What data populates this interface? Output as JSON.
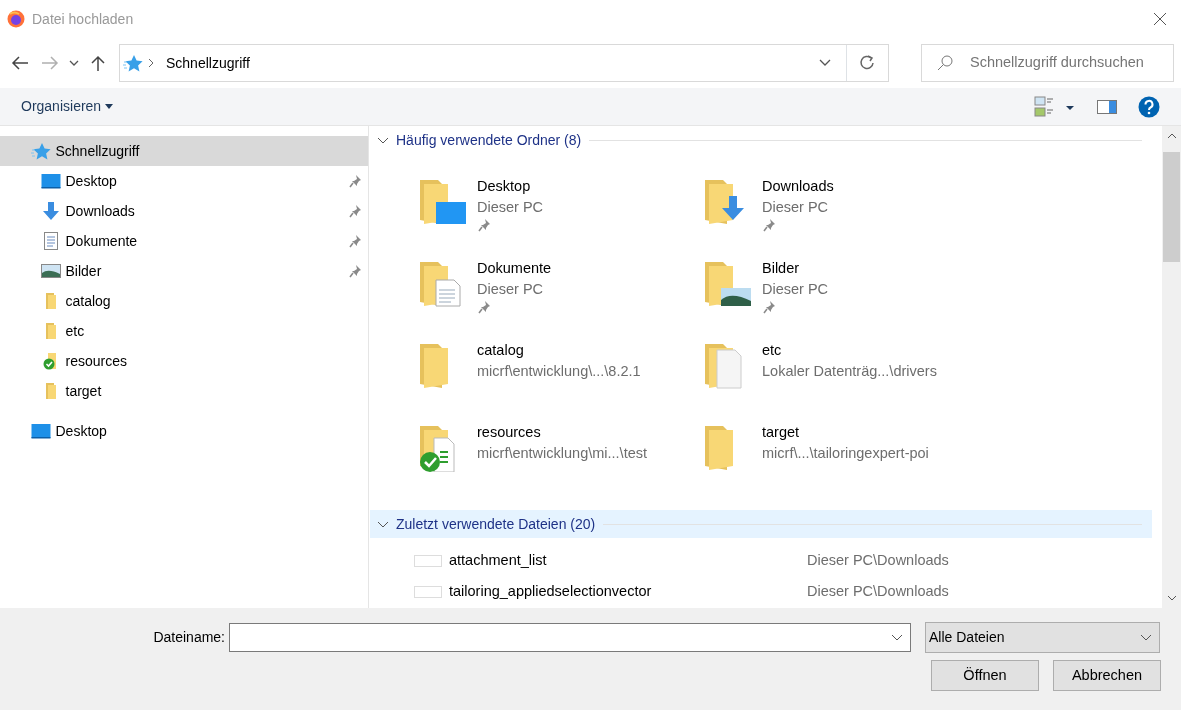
{
  "window": {
    "title": "Datei hochladen"
  },
  "nav": {
    "back": {
      "disabled": false
    },
    "forward": {
      "disabled": true
    },
    "address": {
      "location": "Schnellzugriff"
    },
    "search": {
      "placeholder": "Schnellzugriff durchsuchen"
    }
  },
  "toolbar": {
    "organize": "Organisieren"
  },
  "sidebar": {
    "items": [
      {
        "label": "Schnellzugriff",
        "kind": "quick",
        "selected": true,
        "pinned": false,
        "children": [
          {
            "label": "Desktop",
            "kind": "desktop",
            "selected": false,
            "pinned": true
          },
          {
            "label": "Downloads",
            "kind": "downloads",
            "selected": false,
            "pinned": true
          },
          {
            "label": "Dokumente",
            "kind": "documents",
            "selected": false,
            "pinned": true
          },
          {
            "label": "Bilder",
            "kind": "pictures",
            "selected": false,
            "pinned": true
          },
          {
            "label": "catalog",
            "kind": "folder",
            "selected": false,
            "pinned": false
          },
          {
            "label": "etc",
            "kind": "folder",
            "selected": false,
            "pinned": false
          },
          {
            "label": "resources",
            "kind": "synced",
            "selected": false,
            "pinned": false
          },
          {
            "label": "target",
            "kind": "folder",
            "selected": false,
            "pinned": false
          }
        ]
      },
      {
        "label": "Desktop",
        "kind": "desktop",
        "selected": false,
        "pinned": false
      }
    ]
  },
  "sections": [
    {
      "title": "Häufig verwendete Ordner (8)",
      "kind": "tiles",
      "expanded": true,
      "hovered": false,
      "items": [
        {
          "name": "Desktop",
          "location": "Dieser PC",
          "kind": "desktop",
          "pinned": true
        },
        {
          "name": "Downloads",
          "location": "Dieser PC",
          "kind": "downloads",
          "pinned": true
        },
        {
          "name": "Dokumente",
          "location": "Dieser PC",
          "kind": "documents",
          "pinned": true
        },
        {
          "name": "Bilder",
          "location": "Dieser PC",
          "kind": "pictures",
          "pinned": true
        },
        {
          "name": "catalog",
          "location": "micrf\\entwicklung\\...\\8.2.1",
          "kind": "folder",
          "pinned": false
        },
        {
          "name": "etc",
          "location": "Lokaler Datenträg...\\drivers",
          "kind": "files",
          "pinned": false
        },
        {
          "name": "resources",
          "location": "micrf\\entwicklung\\mi...\\test",
          "kind": "synced",
          "pinned": false
        },
        {
          "name": "target",
          "location": "micrf\\...\\tailoringexpert-poi",
          "kind": "folder",
          "pinned": false
        }
      ]
    },
    {
      "title": "Zuletzt verwendete Dateien (20)",
      "kind": "list",
      "expanded": true,
      "hovered": true,
      "items": [
        {
          "name": "attachment_list",
          "location": "Dieser PC\\Downloads"
        },
        {
          "name": "tailoring_appliedselectionvector",
          "location": "Dieser PC\\Downloads"
        }
      ]
    }
  ],
  "footer": {
    "filename_label": "Dateiname:",
    "filetype": "Alle Dateien",
    "buttons": [
      {
        "label": "Öffnen"
      },
      {
        "label": "Abbrechen"
      }
    ]
  }
}
